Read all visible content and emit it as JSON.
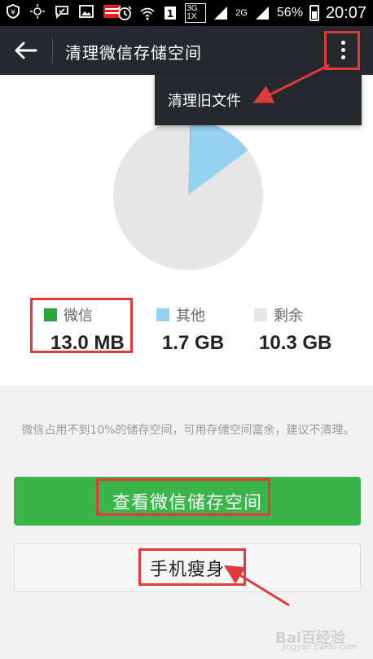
{
  "status_bar": {
    "network": "3G 1X",
    "network2": "2G",
    "battery": "56%",
    "time": "20:07",
    "icons": [
      "shield-icon",
      "brightness-icon",
      "message-icon",
      "image-icon",
      "money-locker-icon",
      "alarm-icon",
      "wifi-icon",
      "sim-icon",
      "signal-icon",
      "battery-icon"
    ]
  },
  "action_bar": {
    "title": "清理微信存储空间",
    "back_icon": "back-arrow-icon",
    "more_icon": "more-vert-icon"
  },
  "overflow_menu": {
    "items": [
      "清理旧文件"
    ]
  },
  "chart_data": {
    "type": "pie",
    "slices": [
      {
        "name": "微信",
        "value": 0.013,
        "unit": "GB",
        "color": "#2aa53a"
      },
      {
        "name": "其他",
        "value": 1.7,
        "unit": "GB",
        "color": "#95d1f1"
      },
      {
        "name": "剩余",
        "value": 10.3,
        "unit": "GB",
        "color": "#e6e6e6"
      }
    ]
  },
  "legend": [
    {
      "label": "微信",
      "value": "13.0 MB",
      "color": "#2aa53a"
    },
    {
      "label": "其他",
      "value": "1.7 GB",
      "color": "#95d1f1"
    },
    {
      "label": "剩余",
      "value": "10.3 GB",
      "color": "#e6e6e6"
    }
  ],
  "description": "微信占用不到10%的储存空间，可用存储空间富余，建议不清理。",
  "buttons": {
    "view_storage": "查看微信储存空间",
    "slim_phone": "手机瘦身"
  },
  "watermark": {
    "text": "Bai百经验",
    "sub": "jingyan.baidu.com"
  },
  "colors": {
    "accent_green": "#3bb54a",
    "action_bar": "#25292e",
    "annotation_red": "#e03a3a"
  }
}
